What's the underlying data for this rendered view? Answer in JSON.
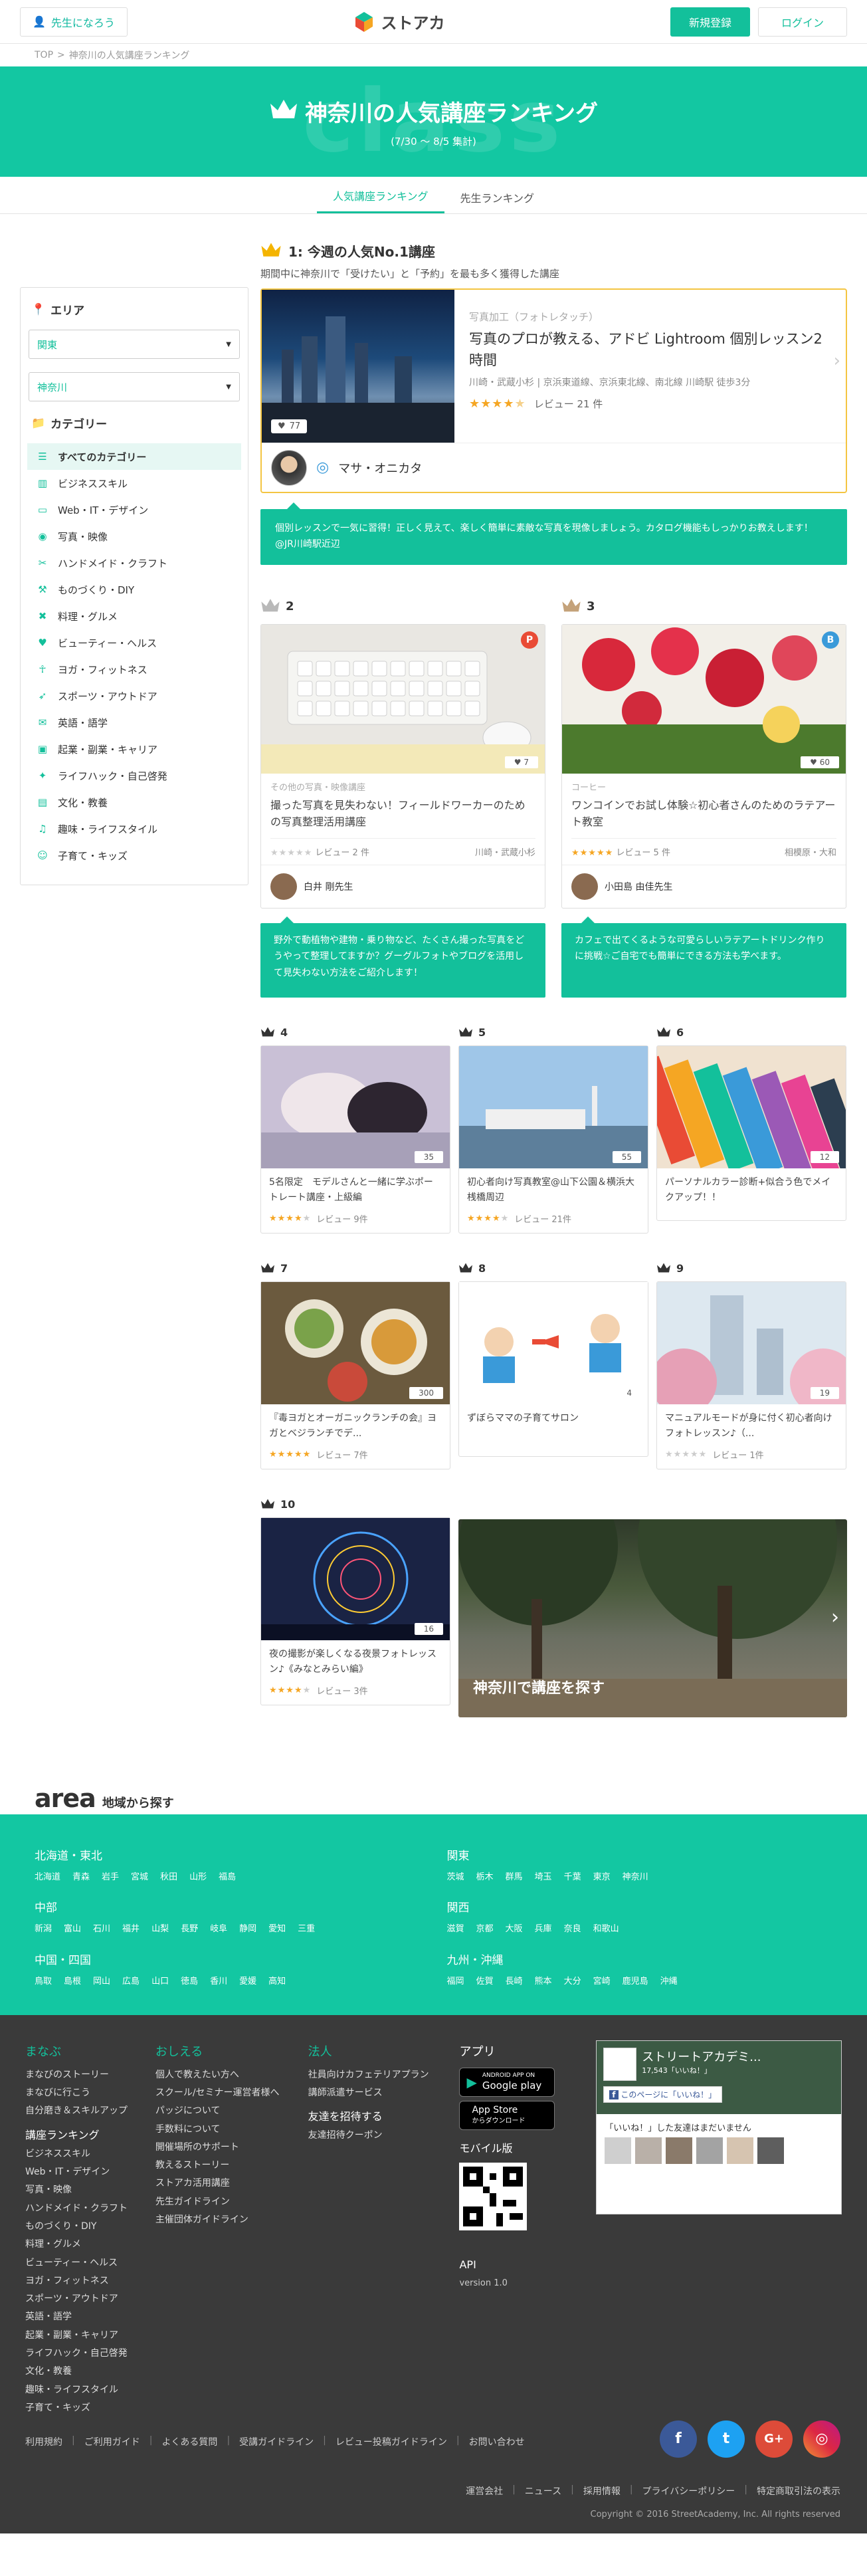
{
  "header": {
    "teacher_label": "先生になろう",
    "logo_text": "ストアカ",
    "signup_label": "新規登録",
    "login_label": "ログイン"
  },
  "breadcrumb": {
    "home": "TOP",
    "sep": ">",
    "current": "神奈川の人気講座ランキング"
  },
  "hero": {
    "watermark": "class",
    "title": "神奈川の人気講座ランキング",
    "period": "(7/30 〜 8/5 集計)"
  },
  "tabs": [
    {
      "label": "人気講座ランキング"
    },
    {
      "label": "先生ランキング"
    }
  ],
  "sidebar": {
    "area_title": "エリア",
    "region_select": "関東",
    "pref_select": "神奈川",
    "category_title": "カテゴリー",
    "categories": [
      {
        "label": "すべてのカテゴリー",
        "icon": "list-icon"
      },
      {
        "label": "ビジネススキル",
        "icon": "chart-icon"
      },
      {
        "label": "Web・IT・デザイン",
        "icon": "monitor-icon"
      },
      {
        "label": "写真・映像",
        "icon": "camera-icon"
      },
      {
        "label": "ハンドメイド・クラフト",
        "icon": "scissors-icon"
      },
      {
        "label": "ものづくり・DIY",
        "icon": "tools-icon"
      },
      {
        "label": "料理・グルメ",
        "icon": "cutlery-icon"
      },
      {
        "label": "ビューティー・ヘルス",
        "icon": "heart-icon"
      },
      {
        "label": "ヨガ・フィットネス",
        "icon": "yoga-icon"
      },
      {
        "label": "スポーツ・アウトドア",
        "icon": "running-icon"
      },
      {
        "label": "英語・語学",
        "icon": "speech-icon"
      },
      {
        "label": "起業・副業・キャリア",
        "icon": "briefcase-icon"
      },
      {
        "label": "ライフハック・自己啓発",
        "icon": "lightbulb-icon"
      },
      {
        "label": "文化・教養",
        "icon": "book-icon"
      },
      {
        "label": "趣味・ライフスタイル",
        "icon": "guitar-icon"
      },
      {
        "label": "子育て・キッズ",
        "icon": "baby-icon"
      }
    ]
  },
  "rank1": {
    "heading": "1: 今週の人気No.1講座",
    "desc": "期間中に神奈川で「受けたい」と「予約」を最も多く獲得した講座",
    "category": "写真加工（フォトレタッチ）",
    "title": "写真のプロが教える、アドビ Lightroom 個別レッスン2時間",
    "location": "川崎・武蔵小杉 | 京浜東道線、京浜東北線、南北線 川崎駅 徒歩3分",
    "likes": "77",
    "rating": 4.5,
    "review": "レビュー 21 件",
    "teacher": "マサ・オニカタ",
    "callout": "個別レッスンで一気に習得！正しく見えて、楽しく簡単に素敵な写真を現像しましょう。カタログ機能もしっかりお教えします！　@JR川崎駅近辺"
  },
  "rank23": [
    {
      "rank": "2",
      "category": "その他の写真・映像講座",
      "title": "撮った写真を見失わない！フィールドワーカーのための写真整理活用講座",
      "likes": "7",
      "rating": 0,
      "review": "レビュー 2 件",
      "location": "川崎・武蔵小杉",
      "teacher": "白井 剛先生",
      "badge": "P",
      "badge_color": "#e94b35",
      "callout": "野外で動植物や建物・乗り物など、たくさん撮った写真をどうやって整理してますか？グーグルフォトやブログを活用して見失わない方法をご紹介します！"
    },
    {
      "rank": "3",
      "category": "コーヒー",
      "title": "ワンコインでお試し体験☆初心者さんのためのラテアート教室",
      "likes": "60",
      "rating": 5,
      "review": "レビュー 5 件",
      "location": "相模原・大和",
      "teacher": "小田島 由佳先生",
      "badge": "B",
      "badge_color": "#3a9ad9",
      "callout": "カフェで出てくるような可愛らしいラテアートドリンク作りに挑戦☆ご自宅でも簡単にできる方法も学べます。"
    }
  ],
  "rank_rest": [
    {
      "rank": "4",
      "likes": "35",
      "title": "5名限定　モデルさんと一緒に学ぶポートレート講座・上級編",
      "rating": 4,
      "review": "レビュー 9件"
    },
    {
      "rank": "5",
      "likes": "55",
      "title": "初心者向け写真教室@山下公園＆横浜大桟橋周辺",
      "rating": 4,
      "review": "レビュー 21件"
    },
    {
      "rank": "6",
      "likes": "12",
      "title": "パーソナルカラー診断+似合う色でメイクアップ！！",
      "rating": -1,
      "review": ""
    },
    {
      "rank": "7",
      "likes": "300",
      "title": "『毒ヨガとオーガニックランチの会』ヨガとベジランチでデ...",
      "rating": 5,
      "review": "レビュー 7件"
    },
    {
      "rank": "8",
      "likes": "4",
      "title": "ずぼらママの子育てサロン",
      "rating": -1,
      "review": ""
    },
    {
      "rank": "9",
      "likes": "19",
      "title": "マニュアルモードが身に付く初心者向けフォトレッスン♪（...",
      "rating": 0,
      "review": "レビュー 1件"
    },
    {
      "rank": "10",
      "likes": "16",
      "title": "夜の撮影が楽しくなる夜景フォトレッスン♪《みなとみらい編》",
      "rating": 4,
      "review": "レビュー 3件"
    }
  ],
  "search_area": {
    "label": "神奈川で講座を探す"
  },
  "area": {
    "logo": "area",
    "subtitle": "地域から探す",
    "regions": [
      {
        "name": "北海道・東北",
        "prefs": [
          "北海道",
          "青森",
          "岩手",
          "宮城",
          "秋田",
          "山形",
          "福島"
        ]
      },
      {
        "name": "関東",
        "prefs": [
          "茨城",
          "栃木",
          "群馬",
          "埼玉",
          "千葉",
          "東京",
          "神奈川"
        ]
      },
      {
        "name": "中部",
        "prefs": [
          "新潟",
          "富山",
          "石川",
          "福井",
          "山梨",
          "長野",
          "岐阜",
          "静岡",
          "愛知",
          "三重"
        ]
      },
      {
        "name": "関西",
        "prefs": [
          "滋賀",
          "京都",
          "大阪",
          "兵庫",
          "奈良",
          "和歌山"
        ]
      },
      {
        "name": "中国・四国",
        "prefs": [
          "鳥取",
          "島根",
          "岡山",
          "広島",
          "山口",
          "徳島",
          "香川",
          "愛媛",
          "高知"
        ]
      },
      {
        "name": "九州・沖縄",
        "prefs": [
          "福岡",
          "佐賀",
          "長崎",
          "熊本",
          "大分",
          "宮崎",
          "鹿児島",
          "沖縄"
        ]
      }
    ]
  },
  "footer": {
    "col1": {
      "title": "まなぶ",
      "links": [
        "まなびのストーリー",
        "まなびに行こう",
        "自分磨き＆スキルアップ"
      ],
      "sub": "講座ランキング",
      "cats": [
        "ビジネススキル",
        "Web・IT・デザイン",
        "写真・映像",
        "ハンドメイド・クラフト",
        "ものづくり・DIY",
        "料理・グルメ",
        "ビューティー・ヘルス",
        "ヨガ・フィットネス",
        "スポーツ・アウトドア",
        "英語・語学",
        "起業・副業・キャリア",
        "ライフハック・自己啓発",
        "文化・教養",
        "趣味・ライフスタイル",
        "子育て・キッズ"
      ]
    },
    "col2": {
      "title": "おしえる",
      "links": [
        "個人で教えたい方へ",
        "スクール/セミナー運営者様へ",
        "パッジについて",
        "手数料について",
        "開催場所のサポート",
        "教えるストーリー",
        "ストアカ活用講座",
        "先生ガイドライン",
        "主催団体ガイドライン"
      ]
    },
    "col3": {
      "title": "法人",
      "links": [
        "社員向けカフェテリアプラン",
        "講師派遣サービス"
      ],
      "sub": "友達を招待する",
      "sublinks": [
        "友達招待クーポン"
      ]
    },
    "col4": {
      "title": "アプリ",
      "google_top": "ANDROID APP ON",
      "google": "Google play",
      "apple_top": "App Store",
      "apple": "からダウンロード",
      "mobile": "モバイル版",
      "api": "API",
      "version": "version 1.0"
    },
    "fb": {
      "page": "ストリートアカデミ...",
      "likes": "17,543「いいね！」",
      "like_btn": "このページに「いいね！」",
      "friends": "「いいね！」した友達はまだいません"
    },
    "bottom_links": [
      "利用規約",
      "ご利用ガイド",
      "よくある質問",
      "受講ガイドライン",
      "レビュー投稿ガイドライン",
      "お問い合わせ"
    ],
    "legal": [
      "運営会社",
      "ニュース",
      "採用情報",
      "プライバシーポリシー",
      "特定商取引法の表示"
    ],
    "copyright": "Copyright © 2016 StreetAcademy, Inc. All rights reserved"
  }
}
